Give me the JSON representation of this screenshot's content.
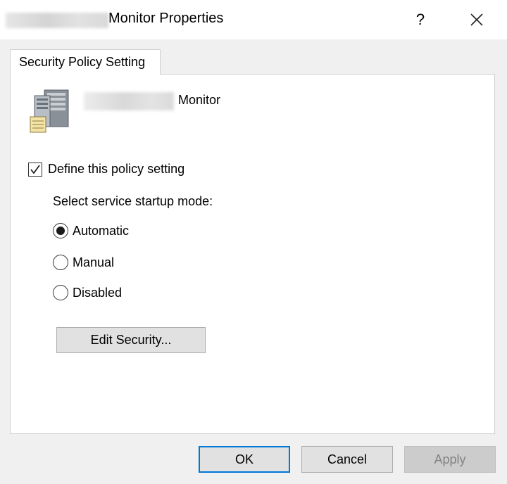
{
  "titlebar": {
    "title": "Monitor Properties",
    "help_glyph": "?",
    "help_icon": "question-mark-icon",
    "close_icon": "close-icon"
  },
  "tab": {
    "label": "Security Policy Setting"
  },
  "service": {
    "name_suffix": "Monitor",
    "icon": "server-icon"
  },
  "policy": {
    "define_label": "Define this policy setting",
    "define_checked": true,
    "startup_label": "Select service startup mode:",
    "options": [
      {
        "label": "Automatic",
        "selected": true
      },
      {
        "label": "Manual",
        "selected": false
      },
      {
        "label": "Disabled",
        "selected": false
      }
    ],
    "edit_security_label": "Edit Security..."
  },
  "buttons": {
    "ok": "OK",
    "cancel": "Cancel",
    "apply": "Apply",
    "apply_enabled": false
  },
  "colors": {
    "accent": "#0078d7",
    "window_bg": "#f0f0f0",
    "disabled_text": "#838383"
  }
}
